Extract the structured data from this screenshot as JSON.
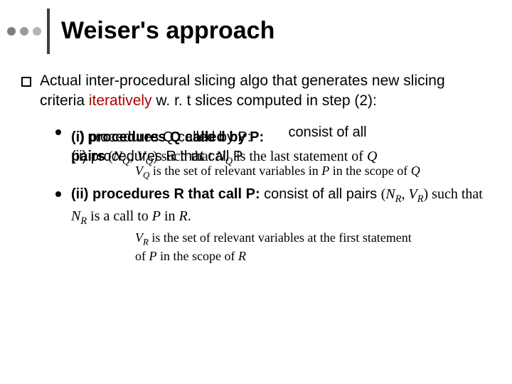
{
  "title": "Weiser's approach",
  "top_point": {
    "pre": "Actual inter-procedural slicing algo that generates new slicing criteria ",
    "iter": "iteratively",
    "post": " w. r. t slices computed in step (2):"
  },
  "sub1": {
    "overlap_plain_a": "(i) procedures Q called by P:",
    "overlap_bold_a": "(i) procedures Q called by P:",
    "tail_a": " consist of all",
    "overlap_plain_b": "(ii) procedures R that call P",
    "overlap_bold_b": "pairs",
    "pair_open": " (",
    "NQ_N": "N",
    "NQ_Q": "Q",
    "comma1": ", ",
    "VQ_V": "V",
    "VQ_Q": "Q",
    "pair_close": ") such that ",
    "NQ2_N": "N",
    "NQ2_Q": "Q",
    "tail_b": " is the last statement of ",
    "Q_end": "Q",
    "desc_VQ_V": "V",
    "desc_VQ_Q": "Q",
    "desc_mid": " is the set of relevant variables in ",
    "desc_P": "P",
    "desc_tail": " in the scope of ",
    "desc_Q": "Q"
  },
  "sub2": {
    "bold": "(ii) procedures R that call P:",
    "tail": " consist of all pairs ",
    "pair_open": "(",
    "NR_N": "N",
    "NR_R": "R",
    "comma": ", ",
    "VR_V": "V",
    "VR_R": "R",
    "pair_close": ") such that ",
    "NR2_N": "N",
    "NR2_R": "R",
    "mid2": " is a call to ",
    "P": "P",
    "mid3": " in ",
    "R": "R",
    "period": ".",
    "desc_VR_V": "V",
    "desc_VR_R": "R",
    "desc_line1": " is the set of relevant variables at the first statement",
    "desc_line2a": "of ",
    "desc_P": "P",
    "desc_line2b": " in the scope of ",
    "desc_R": "R"
  }
}
